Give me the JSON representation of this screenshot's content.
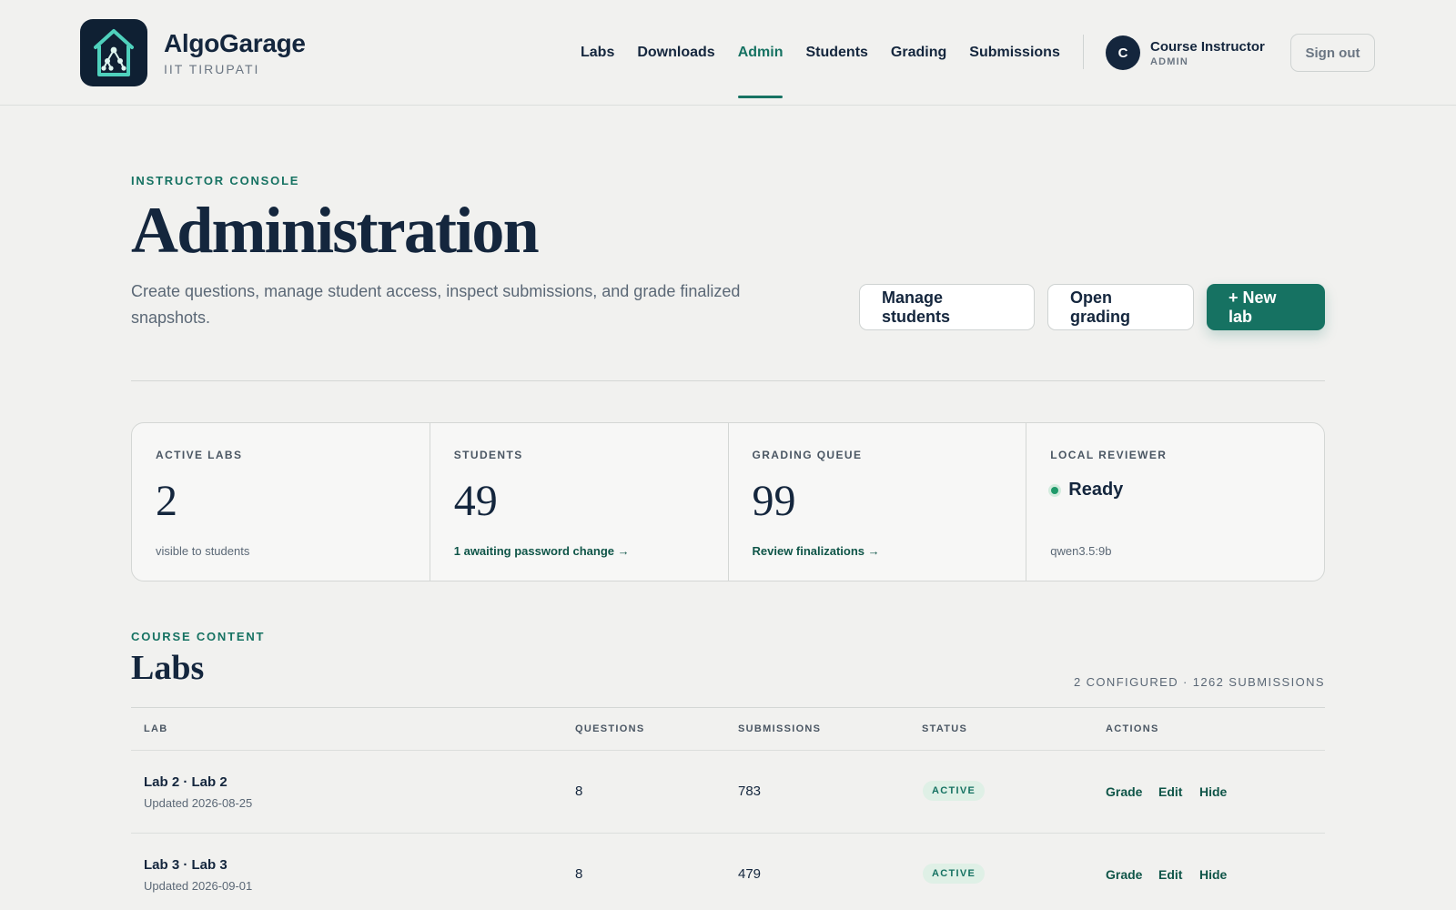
{
  "colors": {
    "accent": "#167262",
    "navy": "#14263d",
    "background": "#f1f1ef",
    "status_ok": "#1f9a6a"
  },
  "brand": {
    "name": "AlgoGarage",
    "subtitle": "IIT TIRUPATI",
    "logo_icon": "house-tree-icon"
  },
  "nav": {
    "items": [
      "Labs",
      "Downloads",
      "Admin",
      "Students",
      "Grading",
      "Submissions"
    ],
    "active": "Admin"
  },
  "user": {
    "initial": "C",
    "name": "Course Instructor",
    "role": "ADMIN",
    "signout_label": "Sign out"
  },
  "hero": {
    "eyebrow": "INSTRUCTOR CONSOLE",
    "title": "Administration",
    "description": "Create questions, manage student access, inspect submissions, and grade finalized snapshots.",
    "buttons": {
      "manage_students": "Manage students",
      "open_grading": "Open grading",
      "new_lab": "+ New lab"
    }
  },
  "stats": {
    "active_labs": {
      "label": "ACTIVE LABS",
      "value": "2",
      "foot": "visible to students"
    },
    "students": {
      "label": "STUDENTS",
      "value": "49",
      "link": "1 awaiting password change →"
    },
    "grading_queue": {
      "label": "GRADING QUEUE",
      "value": "99",
      "link": "Review finalizations →"
    },
    "local_reviewer": {
      "label": "LOCAL REVIEWER",
      "status": "Ready",
      "model": "qwen3.5:9b"
    }
  },
  "labs": {
    "eyebrow": "COURSE CONTENT",
    "title": "Labs",
    "summary": "2 CONFIGURED · 1262 SUBMISSIONS",
    "columns": [
      "LAB",
      "QUESTIONS",
      "SUBMISSIONS",
      "STATUS",
      "ACTIONS"
    ],
    "rows": [
      {
        "name": "Lab 2 · Lab 2",
        "updated": "Updated 2026-08-25",
        "questions": "8",
        "submissions": "783",
        "status": "ACTIVE",
        "actions": [
          "Grade",
          "Edit",
          "Hide"
        ]
      },
      {
        "name": "Lab 3 · Lab 3",
        "updated": "Updated 2026-09-01",
        "questions": "8",
        "submissions": "479",
        "status": "ACTIVE",
        "actions": [
          "Grade",
          "Edit",
          "Hide"
        ]
      }
    ]
  }
}
